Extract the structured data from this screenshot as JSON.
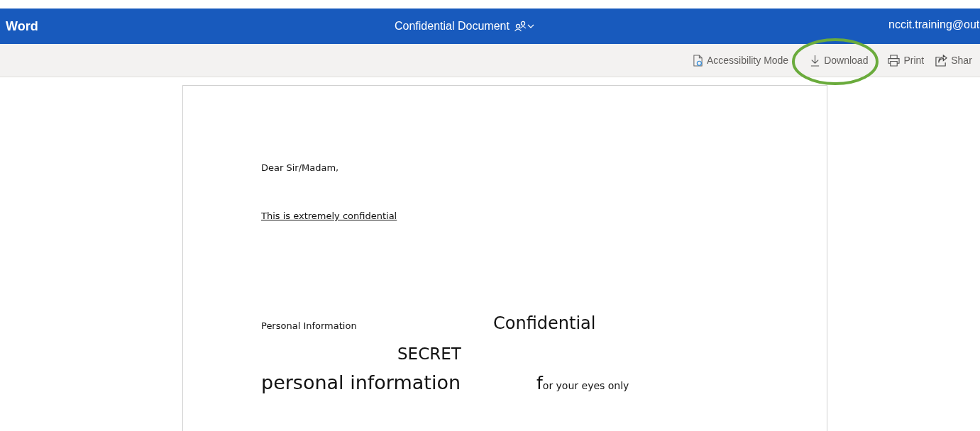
{
  "app_bar": {
    "app_name": "Word",
    "document_title": "Confidential Document",
    "account": "nccit.training@out"
  },
  "toolbar": [
    {
      "kind": "accessibility",
      "label": "Accessibility Mode"
    },
    {
      "kind": "download",
      "label": "Download"
    },
    {
      "kind": "print",
      "label": "Print"
    },
    {
      "kind": "share",
      "label": "Shar"
    }
  ],
  "document": {
    "greeting": "Dear Sir/Madam,",
    "underlined_line": "This is extremely confidential",
    "small_heading": "Personal Information",
    "large_heading": "Confidential",
    "secret": "SECRET",
    "large_lower": "personal information",
    "eyes_only": {
      "initial": "f",
      "rest": "or your eyes only"
    }
  }
}
